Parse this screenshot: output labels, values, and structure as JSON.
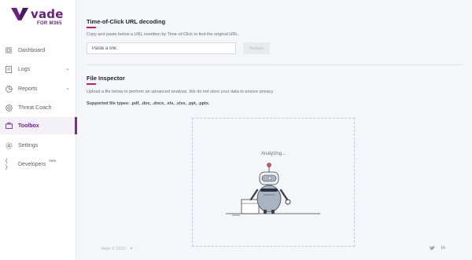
{
  "brand": {
    "name": "vade",
    "subtitle": "FOR M365",
    "color": "#6b1f86"
  },
  "sidebar": {
    "items": [
      {
        "label": "Dashboard",
        "icon": "grid-icon"
      },
      {
        "label": "Logs",
        "icon": "file-icon",
        "expandable": true
      },
      {
        "label": "Reports",
        "icon": "pie-chart-icon",
        "expandable": true
      },
      {
        "label": "Threat Coach",
        "icon": "target-icon"
      },
      {
        "label": "Toolbox",
        "icon": "briefcase-icon",
        "active": true
      },
      {
        "label": "Settings",
        "icon": "gear-icon"
      },
      {
        "label": "Developers",
        "icon": "code-braces-icon",
        "badge": "New"
      }
    ]
  },
  "url_decoding": {
    "title": "Time-of-Click URL decoding",
    "description": "Copy and paste below a URL rewritten by Time-of-Click to find the original URL.",
    "input_placeholder": "Paste a link",
    "input_value": "",
    "button_label": "Analyze"
  },
  "file_inspector": {
    "title": "File Inspector",
    "description": "Upload a file below to perform an advanced analysis. We do not store your data to ensure privacy.",
    "supported_types": "Supported file types: .pdf, .doc, .docx, .xls, .xlsx, .ppt, .pptx.",
    "status": "Analyzing..."
  },
  "footer": {
    "copyright": "Vade © 2022",
    "social": [
      "twitter-icon",
      "linkedin-icon"
    ]
  },
  "colors": {
    "accent": "#c51f6b",
    "active_bar": "#7b2a96"
  }
}
